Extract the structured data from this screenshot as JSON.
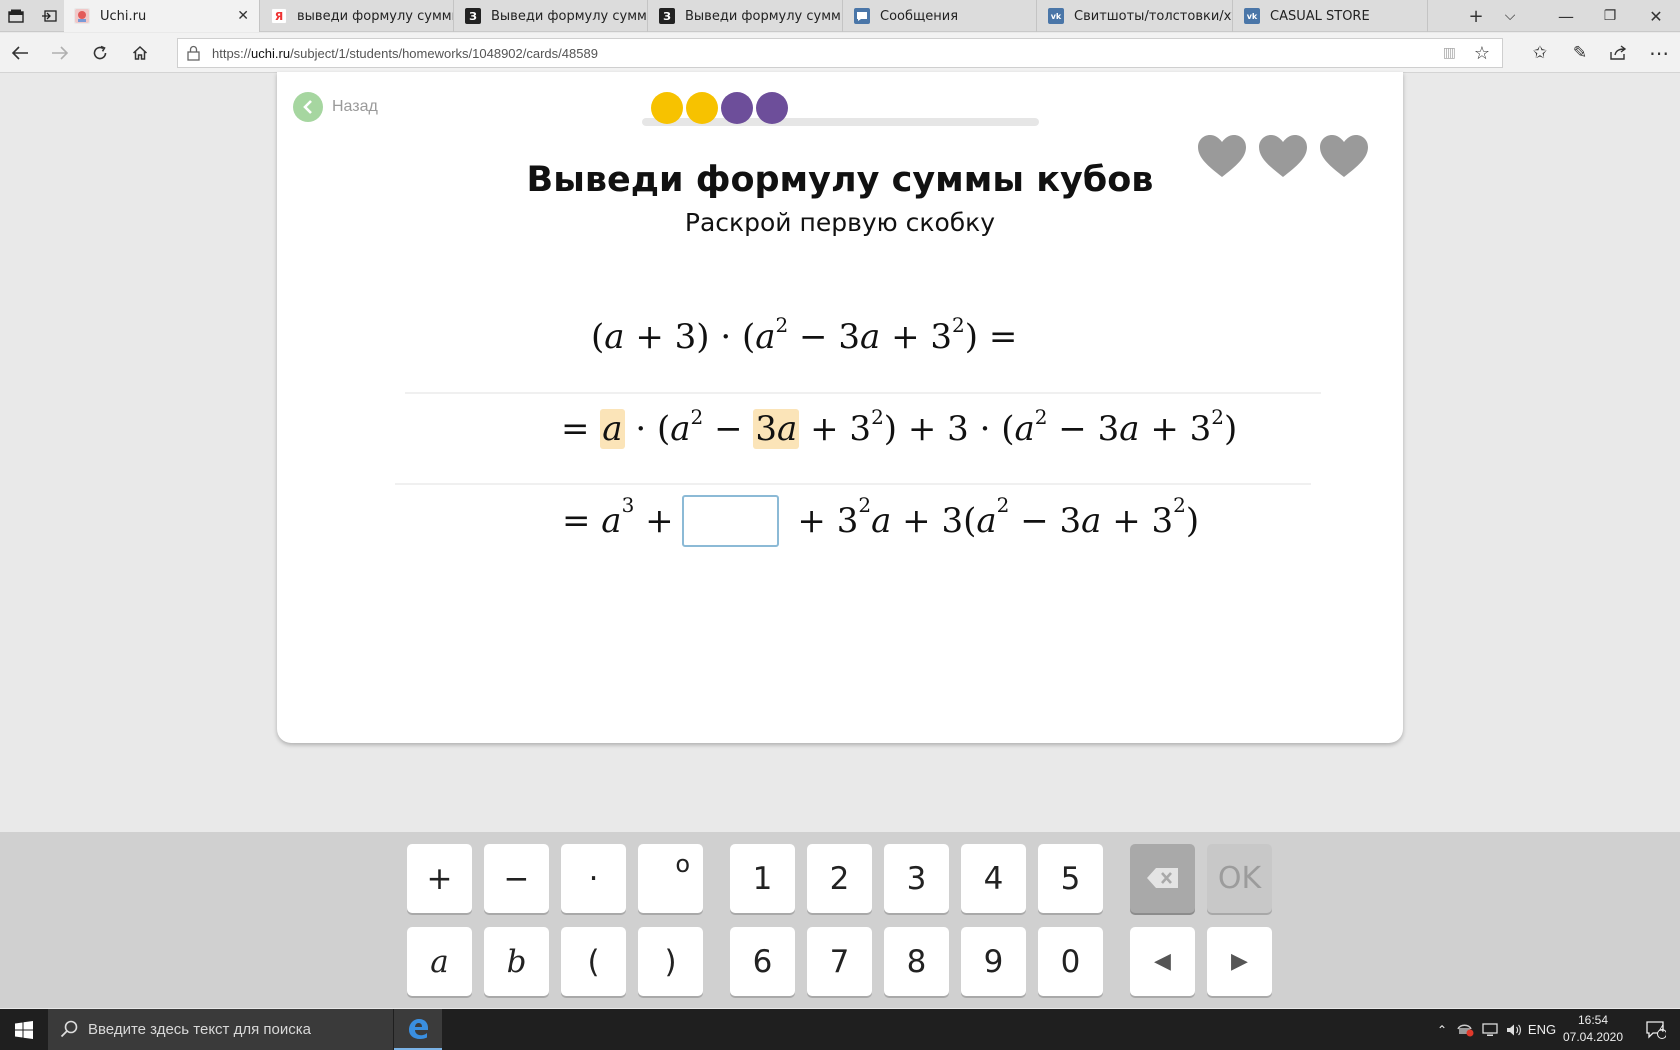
{
  "browser": {
    "tabs": [
      {
        "title": "Uchi.ru",
        "active": true,
        "favicon": "uchi-favicon"
      },
      {
        "title": "выведи формулу суммы к",
        "active": false,
        "favicon": "yandex-favicon"
      },
      {
        "title": "Выведи формулу суммы к",
        "active": false,
        "favicon": "znanija-favicon"
      },
      {
        "title": "Выведи формулу суммы к",
        "active": false,
        "favicon": "znanija-favicon"
      },
      {
        "title": "Сообщения",
        "active": false,
        "favicon": "messages-favicon"
      },
      {
        "title": "Свитшоты/толстовки/худи",
        "active": false,
        "favicon": "vk-favicon"
      },
      {
        "title": "CASUAL STORE",
        "active": false,
        "favicon": "vk-favicon"
      }
    ],
    "url_prefix": "https://",
    "url_host": "uchi.ru",
    "url_path": "/subject/1/students/homeworks/1048902/cards/48589"
  },
  "task": {
    "back_label": "Назад",
    "title": "Выведи формулу суммы кубов",
    "subtitle": "Раскрой первую скобку",
    "progress_dots": [
      "#f7c200",
      "#f7c200",
      "#6d4e9a",
      "#6d4e9a"
    ],
    "hearts_count": 3,
    "heart_color": "#9a9a9a",
    "line1": {
      "sign": "",
      "t1": "(",
      "a": "a",
      "t2": " + 3) · (",
      "b": "a",
      "sup1": "2",
      "t3": " − 3",
      "c": "a",
      "t4": " + 3",
      "sup2": "2",
      "t5": ") ="
    },
    "line2": {
      "eq": "= ",
      "hl1": "a",
      "t1": " · (",
      "b": "a",
      "sup1": "2",
      "t2": " − ",
      "hl2_num": "3",
      "hl2_var": "a",
      "t3": " + 3",
      "sup2": "2",
      "t4": ") + 3  · (",
      "c": "a",
      "sup3": "2",
      "t5": " − 3",
      "d": "a",
      "t6": " + 3",
      "sup4": "2",
      "t7": ")"
    },
    "line3": {
      "eq": "= ",
      "a": "a",
      "sup1": "3",
      "t1": " +",
      "t2": " + 3",
      "sup2": "2",
      "b": "a",
      "t3": " + 3(",
      "c": "a",
      "sup3": "2",
      "t4": " − 3",
      "d": "a",
      "t5": " + 3",
      "sup4": "2",
      "t6": ")"
    }
  },
  "keyboard": {
    "row1": [
      "+",
      "−",
      "·",
      "o",
      "1",
      "2",
      "3",
      "4",
      "5",
      "⌫",
      "OK"
    ],
    "row2": [
      "a",
      "b",
      "(",
      ")",
      "6",
      "7",
      "8",
      "9",
      "0",
      "◀",
      "▶"
    ]
  },
  "taskbar": {
    "search_placeholder": "Введите здесь текст для поиска",
    "lang": "ENG",
    "time": "16:54",
    "date": "07.04.2020",
    "notifications": "4"
  }
}
